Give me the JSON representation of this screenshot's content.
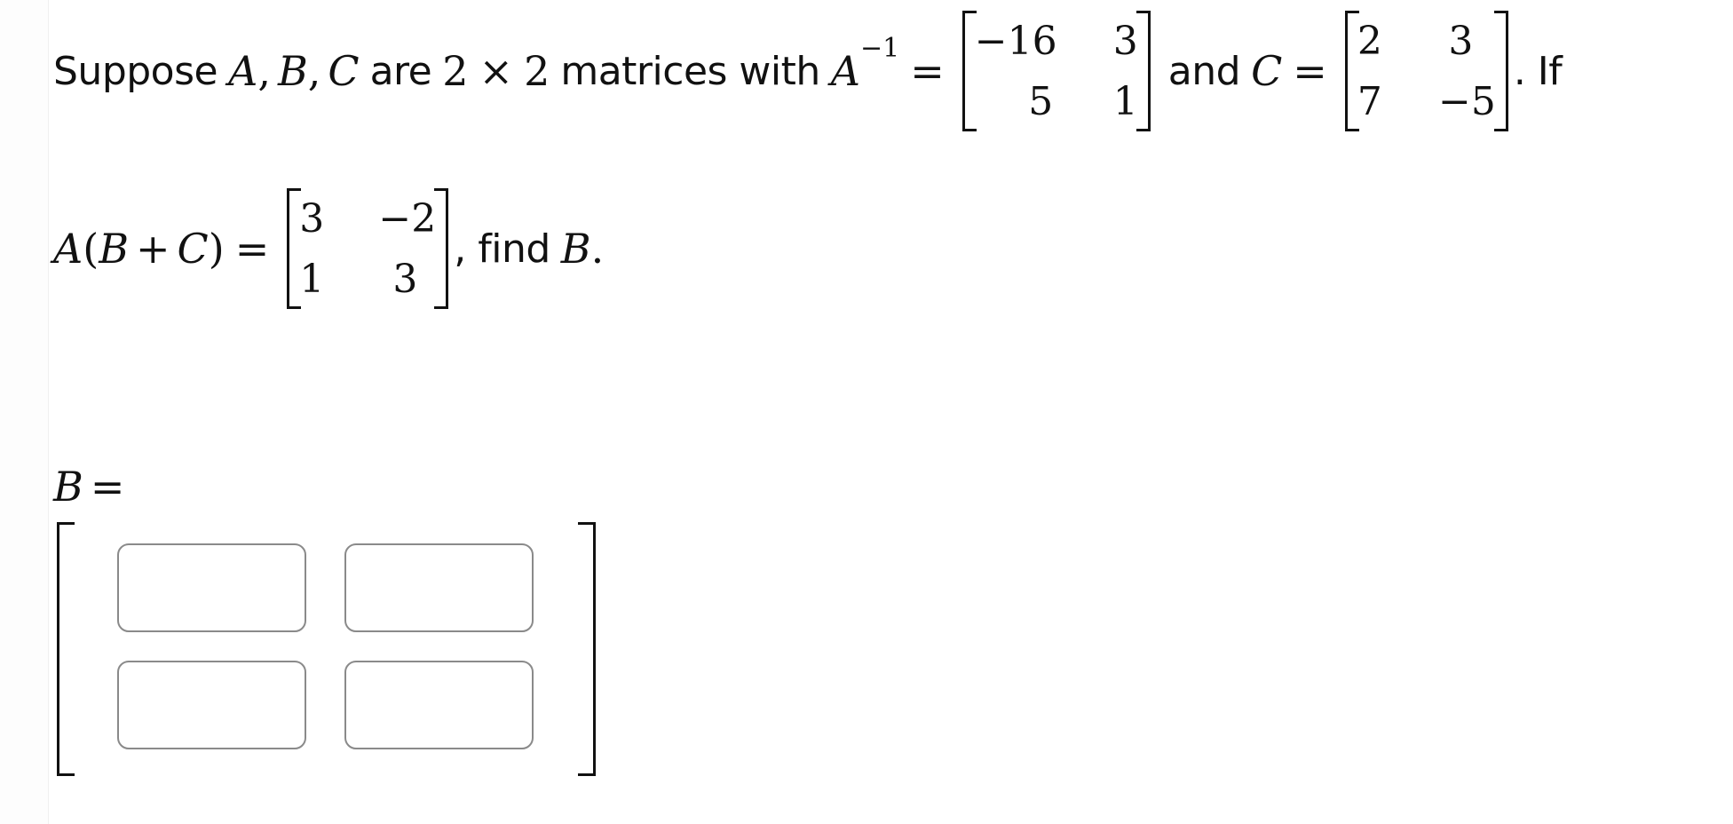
{
  "question": {
    "line1": {
      "t_suppose": "Suppose",
      "v_A": "A",
      "comma1": ",",
      "v_B": "B",
      "comma2": ",",
      "v_C": "C",
      "t_are": "are",
      "n_2a": "2",
      "times": "×",
      "n_2b": "2",
      "t_matrices_with": "matrices with",
      "v_Ainv": "A",
      "sup_inv": "−1",
      "eq1": "=",
      "t_and": "and",
      "v_C2": "C",
      "eq2": "=",
      "t_period_if": ". If"
    },
    "A_inverse": [
      [
        "−16",
        "3"
      ],
      [
        "5",
        "1"
      ]
    ],
    "C": [
      [
        "2",
        "3"
      ],
      [
        "7",
        "−5"
      ]
    ],
    "line2": {
      "v_A": "A",
      "lparen": "(",
      "v_B": "B",
      "plus": "+",
      "v_C": "C",
      "rparen": ")",
      "eq": "=",
      "t_find": ", find",
      "v_B2": "B",
      "period": "."
    },
    "A_times_B_plus_C": [
      [
        "3",
        "−2"
      ],
      [
        "1",
        "3"
      ]
    ]
  },
  "answer": {
    "label_var": "B",
    "label_eq": "=",
    "inputs": [
      [
        "",
        ""
      ],
      [
        "",
        ""
      ]
    ]
  }
}
